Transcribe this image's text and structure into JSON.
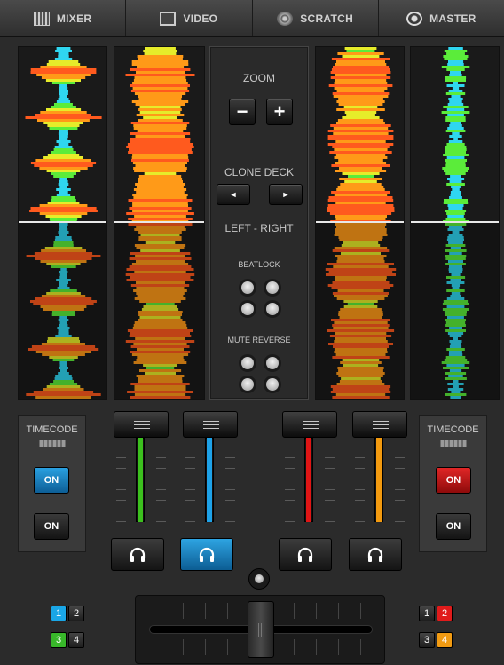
{
  "tabs": [
    {
      "label": "MIXER",
      "icon": "mixer-icon"
    },
    {
      "label": "VIDEO",
      "icon": "video-icon"
    },
    {
      "label": "SCRATCH",
      "icon": "scratch-icon"
    },
    {
      "label": "MASTER",
      "icon": "master-icon"
    }
  ],
  "center": {
    "zoom_label": "ZOOM",
    "zoom_minus": "−",
    "zoom_plus": "+",
    "clone_deck_label": "CLONE DECK",
    "clone_left": "◄",
    "clone_right": "►",
    "left_right_label": "LEFT - RIGHT",
    "beatlock_label": "BEATLOCK",
    "mute_reverse_label": "MUTE REVERSE"
  },
  "timecode_left": {
    "label": "TIMECODE",
    "on_top": "ON",
    "on_bottom": "ON",
    "top_active": true,
    "active_color": "#1a8fd1"
  },
  "timecode_right": {
    "label": "TIMECODE",
    "on_top": "ON",
    "on_bottom": "ON",
    "top_active": true,
    "active_color": "#d11a1a"
  },
  "channel_faders": [
    {
      "deck": 3,
      "color": "#3cc01e",
      "level": 1.0
    },
    {
      "deck": 1,
      "color": "#1ea2e8",
      "level": 1.0
    },
    {
      "deck": 2,
      "color": "#e01515",
      "level": 1.0
    },
    {
      "deck": 4,
      "color": "#f39a0f",
      "level": 1.0
    }
  ],
  "headphone_buttons": [
    {
      "icon": "headphones-icon",
      "active": false
    },
    {
      "icon": "headphones-icon",
      "active": true
    },
    {
      "icon": "headphones-icon",
      "active": false
    },
    {
      "icon": "headphones-icon",
      "active": false
    }
  ],
  "deck_select_left": [
    "1",
    "2",
    "3",
    "4"
  ],
  "deck_select_right": [
    "1",
    "2",
    "3",
    "4"
  ],
  "crossfader_position": 0.5,
  "colors": {
    "blue": "#1aa6e6",
    "green": "#38b82a",
    "red": "#e01b1b",
    "orange": "#f29b12"
  }
}
